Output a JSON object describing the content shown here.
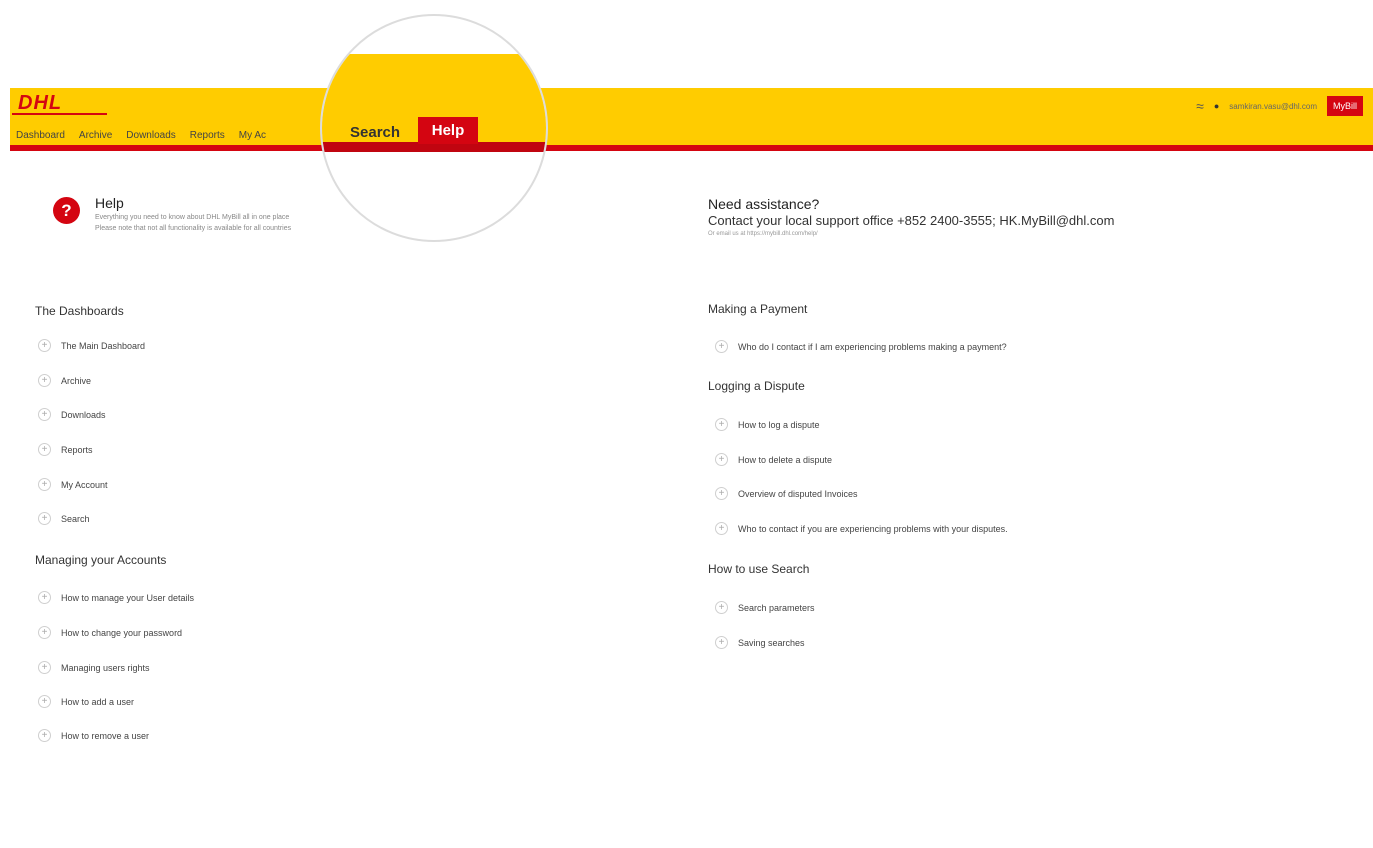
{
  "header": {
    "logo": "DHL",
    "nav": [
      "Dashboard",
      "Archive",
      "Downloads",
      "Reports",
      "My Ac"
    ],
    "user_email": "samkiran.vasu@dhl.com",
    "mybill": "MyBill"
  },
  "magnifier": {
    "search": "Search",
    "help": "Help"
  },
  "help_intro": {
    "title": "Help",
    "line1": "Everything you need to know about DHL MyBill all in one place",
    "line2": "Please note that not all functionality is available for all countries"
  },
  "assistance": {
    "title": "Need assistance?",
    "contact": "Contact your local support office +852 2400-3555; HK.MyBill@dhl.com",
    "email_note": "Or email us at https://mybill.dhl.com/help/"
  },
  "left": {
    "dashboards": {
      "title": "The Dashboards",
      "items": [
        "The Main Dashboard",
        "Archive",
        "Downloads",
        "Reports",
        "My Account",
        "Search"
      ]
    },
    "accounts": {
      "title": "Managing your Accounts",
      "items": [
        "How to manage your User details",
        "How to change your password",
        "Managing users rights",
        "How to add a user",
        "How to remove a user"
      ]
    }
  },
  "right": {
    "payment": {
      "title": "Making a Payment",
      "items": [
        "Who do I contact if I am experiencing problems making a payment?"
      ]
    },
    "dispute": {
      "title": "Logging a Dispute",
      "items": [
        "How to log a dispute",
        "How to delete a dispute",
        "Overview of disputed Invoices",
        "Who to contact if you are experiencing problems with your disputes."
      ]
    },
    "search": {
      "title": "How to use Search",
      "items": [
        "Search parameters",
        "Saving searches"
      ]
    }
  },
  "colors": {
    "brand_yellow": "#ffcc00",
    "brand_red": "#d40511"
  }
}
